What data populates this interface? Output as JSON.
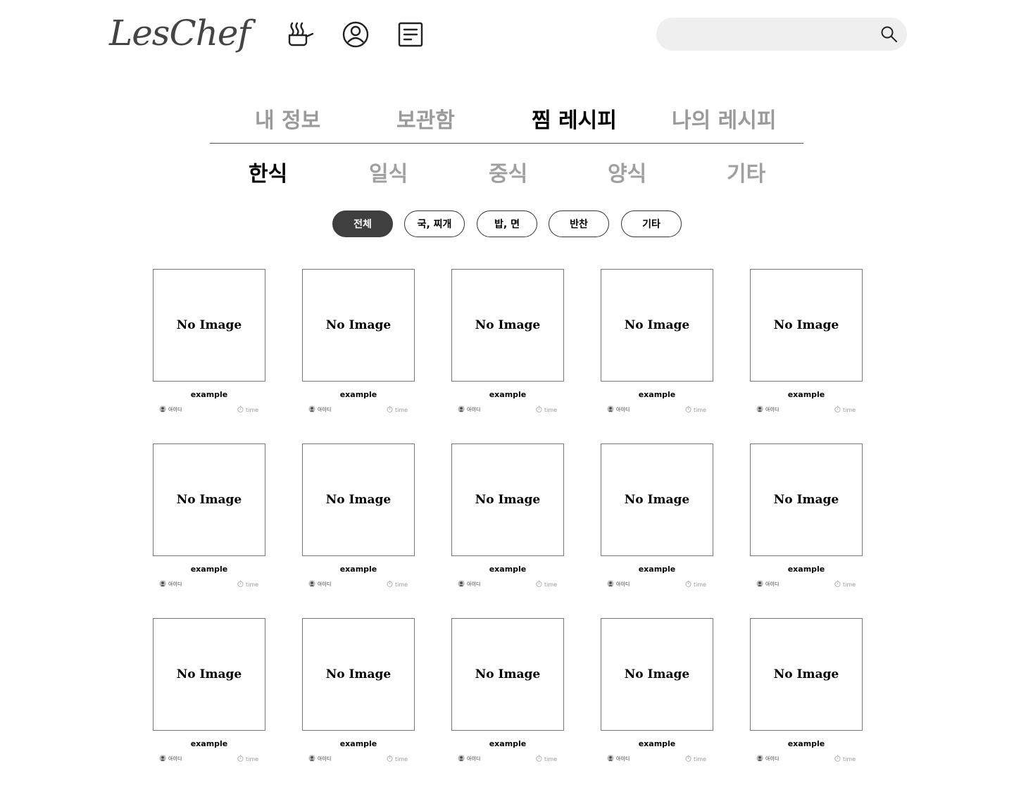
{
  "header": {
    "logo": "LesChef",
    "nav_icons": [
      "cooking-pot-icon",
      "user-profile-icon",
      "document-list-icon"
    ],
    "search": {
      "value": "",
      "placeholder": ""
    }
  },
  "main_tabs": [
    {
      "label": "내 정보",
      "active": false
    },
    {
      "label": "보관함",
      "active": false
    },
    {
      "label": "찜 레시피",
      "active": true
    },
    {
      "label": "나의 레시피",
      "active": false
    }
  ],
  "cuisine_tabs": [
    {
      "label": "한식",
      "active": true
    },
    {
      "label": "일식",
      "active": false
    },
    {
      "label": "중식",
      "active": false
    },
    {
      "label": "양식",
      "active": false
    },
    {
      "label": "기타",
      "active": false
    }
  ],
  "filters": [
    {
      "label": "전체",
      "active": true
    },
    {
      "label": "국, 찌개",
      "active": false
    },
    {
      "label": "밥, 면",
      "active": false
    },
    {
      "label": "반찬",
      "active": false
    },
    {
      "label": "기타",
      "active": false
    }
  ],
  "recipes": [
    {
      "image": "No Image",
      "title": "example",
      "author": "아이디",
      "time": "time"
    },
    {
      "image": "No Image",
      "title": "example",
      "author": "아이디",
      "time": "time"
    },
    {
      "image": "No Image",
      "title": "example",
      "author": "아이디",
      "time": "time"
    },
    {
      "image": "No Image",
      "title": "example",
      "author": "아이디",
      "time": "time"
    },
    {
      "image": "No Image",
      "title": "example",
      "author": "아이디",
      "time": "time"
    },
    {
      "image": "No Image",
      "title": "example",
      "author": "아이디",
      "time": "time"
    },
    {
      "image": "No Image",
      "title": "example",
      "author": "아이디",
      "time": "time"
    },
    {
      "image": "No Image",
      "title": "example",
      "author": "아이디",
      "time": "time"
    },
    {
      "image": "No Image",
      "title": "example",
      "author": "아이디",
      "time": "time"
    },
    {
      "image": "No Image",
      "title": "example",
      "author": "아이디",
      "time": "time"
    },
    {
      "image": "No Image",
      "title": "example",
      "author": "아이디",
      "time": "time"
    },
    {
      "image": "No Image",
      "title": "example",
      "author": "아이디",
      "time": "time"
    },
    {
      "image": "No Image",
      "title": "example",
      "author": "아이디",
      "time": "time"
    },
    {
      "image": "No Image",
      "title": "example",
      "author": "아이디",
      "time": "time"
    },
    {
      "image": "No Image",
      "title": "example",
      "author": "아이디",
      "time": "time"
    }
  ],
  "colors": {
    "active_pill_bg": "#3f3f3f",
    "inactive_tab": "#9a9a9a",
    "search_bg": "#efefef"
  }
}
